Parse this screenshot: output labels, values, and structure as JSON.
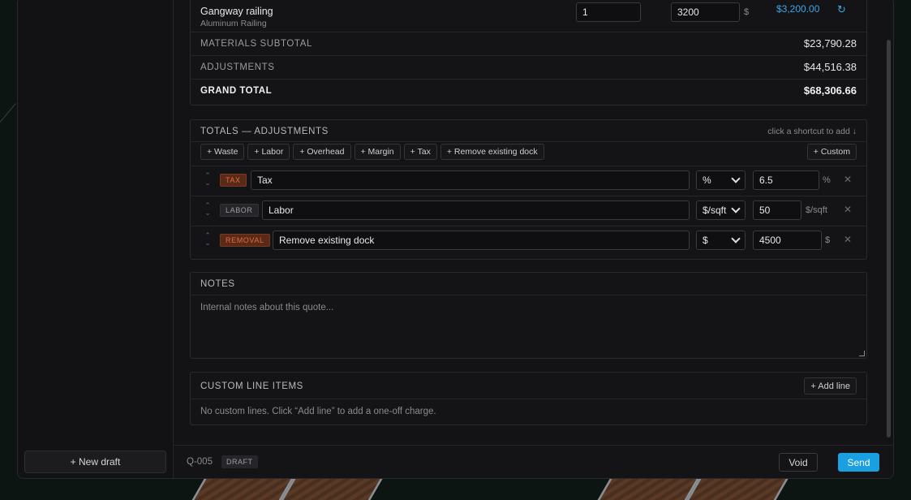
{
  "line_item": {
    "name": "Gangway railing",
    "subtitle": "Aluminum Railing",
    "qty": "1",
    "price": "3200",
    "currency": "$",
    "line_total": "$3,200.00",
    "reset_icon": "undo-icon"
  },
  "summary": {
    "materials_subtotal_label": "MATERIALS SUBTOTAL",
    "materials_subtotal_value": "$23,790.28",
    "adjustments_label": "ADJUSTMENTS",
    "adjustments_value": "$44,516.38",
    "grand_total_label": "GRAND TOTAL",
    "grand_total_value": "$68,306.66"
  },
  "adjustments": {
    "title": "TOTALS — ADJUSTMENTS",
    "hint": "click a shortcut to add ↓",
    "shortcuts": [
      "+ Waste",
      "+ Labor",
      "+ Overhead",
      "+ Margin",
      "+ Tax",
      "+ Remove existing dock"
    ],
    "custom_label": "+ Custom",
    "rows": [
      {
        "tag": "TAX",
        "name": "Tax",
        "unit_select": "%",
        "value": "6.5",
        "unit_suffix": "%",
        "tag_color": "#e06a3f"
      },
      {
        "tag": "LABOR",
        "name": "Labor",
        "unit_select": "$/sqft",
        "value": "50",
        "unit_suffix": "$/sqft",
        "tag_color": "#8a8a90"
      },
      {
        "tag": "REMOVAL",
        "name": "Remove existing dock",
        "unit_select": "$",
        "value": "4500",
        "unit_suffix": "$",
        "tag_color": "#e06a3f"
      }
    ]
  },
  "notes": {
    "title": "NOTES",
    "placeholder": "Internal notes about this quote..."
  },
  "custom_lines": {
    "title": "CUSTOM LINE ITEMS",
    "add_label": "+ Add line",
    "empty": "No custom lines. Click “Add line” to add a one-off charge."
  },
  "sidebar": {
    "new_draft_label": "+ New draft"
  },
  "footer": {
    "quote_id": "Q-005",
    "status": "DRAFT",
    "void_label": "Void",
    "send_label": "Send"
  },
  "colors": {
    "accent": "#1a9fe0",
    "line_total": "#3aa6e6",
    "tag_orange": "#e06a3f"
  }
}
